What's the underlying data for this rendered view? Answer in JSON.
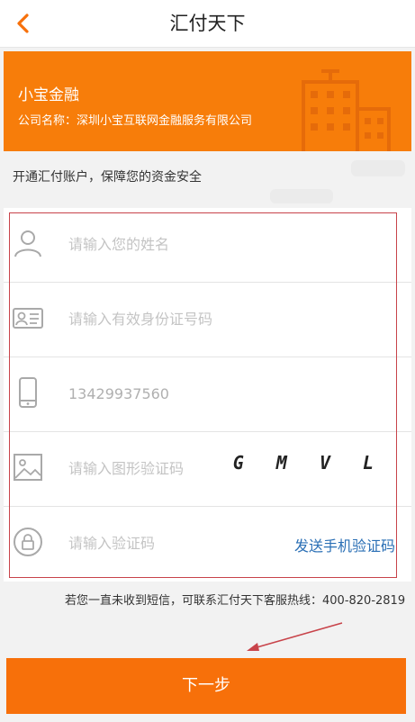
{
  "header": {
    "title": "汇付天下",
    "back_icon": "chevron-left-icon"
  },
  "banner": {
    "name": "小宝金融",
    "company": "公司名称：深圳小宝互联网金融服务有限公司",
    "background": "#f77d0a",
    "icon": "building-icon"
  },
  "notice": "开通汇付账户，保障您的资金安全",
  "form": {
    "name_placeholder": "请输入您的姓名",
    "id_placeholder": "请输入有效身份证号码",
    "phone_value": "13429937560",
    "captcha_placeholder": "请输入图形验证码",
    "captcha_text": "G M V L",
    "sms_placeholder": "请输入验证码",
    "send_code_label": "发送手机验证码"
  },
  "hint": "若您一直未收到短信，可联系汇付天下客服热线：400-820-2819",
  "next_label": "下一步",
  "colors": {
    "accent": "#f7700a",
    "link": "#2a6fb5",
    "frame": "#c8434a"
  }
}
